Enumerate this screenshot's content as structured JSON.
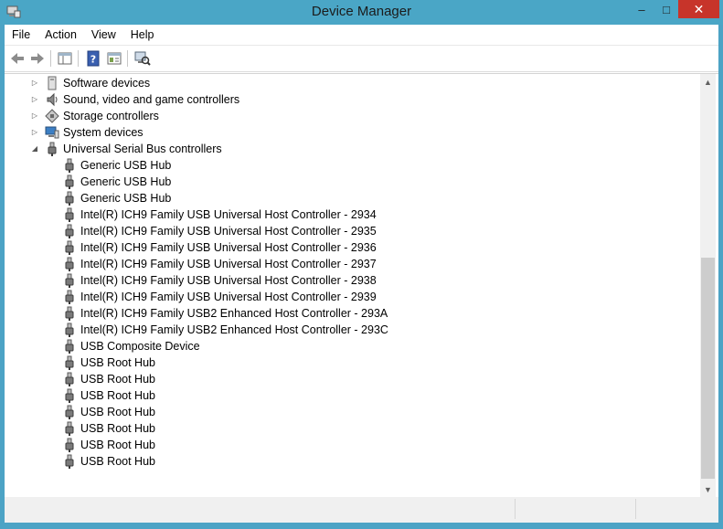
{
  "window": {
    "title": "Device Manager"
  },
  "title_buttons": {
    "minimize": "‒",
    "maximize": "□",
    "close": "✕"
  },
  "menu": [
    "File",
    "Action",
    "View",
    "Help"
  ],
  "toolbar": {
    "buttons": [
      "back-icon",
      "forward-icon",
      "show-hide-console-tree-icon",
      "help-icon",
      "properties-icon",
      "scan-hardware-icon"
    ]
  },
  "tree": {
    "categories": [
      {
        "label": "Software devices",
        "icon": "software-device-icon",
        "expanded": false
      },
      {
        "label": "Sound, video and game controllers",
        "icon": "speaker-icon",
        "expanded": false
      },
      {
        "label": "Storage controllers",
        "icon": "storage-controller-icon",
        "expanded": false
      },
      {
        "label": "System devices",
        "icon": "computer-icon",
        "expanded": false
      },
      {
        "label": "Universal Serial Bus controllers",
        "icon": "usb-icon",
        "expanded": true
      }
    ],
    "usb_devices": [
      "Generic USB Hub",
      "Generic USB Hub",
      "Generic USB Hub",
      "Intel(R) ICH9 Family USB Universal Host Controller - 2934",
      "Intel(R) ICH9 Family USB Universal Host Controller - 2935",
      "Intel(R) ICH9 Family USB Universal Host Controller - 2936",
      "Intel(R) ICH9 Family USB Universal Host Controller - 2937",
      "Intel(R) ICH9 Family USB Universal Host Controller - 2938",
      "Intel(R) ICH9 Family USB Universal Host Controller - 2939",
      "Intel(R) ICH9 Family USB2 Enhanced Host Controller - 293A",
      "Intel(R) ICH9 Family USB2 Enhanced Host Controller - 293C",
      "USB Composite Device",
      "USB Root Hub",
      "USB Root Hub",
      "USB Root Hub",
      "USB Root Hub",
      "USB Root Hub",
      "USB Root Hub",
      "USB Root Hub"
    ]
  },
  "colors": {
    "titlebar": "#4aa6c6",
    "close": "#c7342a"
  }
}
